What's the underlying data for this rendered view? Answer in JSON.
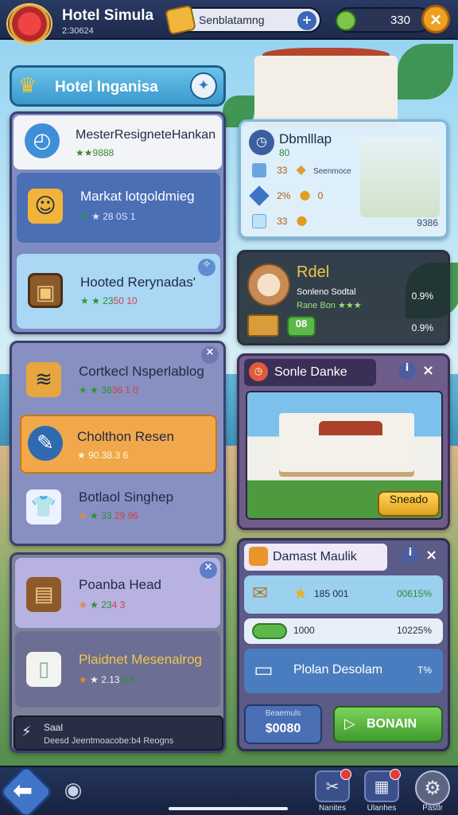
{
  "app": {
    "title": "Hotel Simula",
    "subtitle": "2:30624"
  },
  "topbar": {
    "status_label": "Senblatamng",
    "status_btn": "+",
    "coins": "330",
    "close_label": "×",
    "icons": {
      "logo": "hotel-crest",
      "status": "gold-ticket",
      "coin": "green-coin",
      "close": "close"
    }
  },
  "left_panel": {
    "header": "Hotel Inganisa",
    "items": [
      {
        "name": "MesterResigneteHankan",
        "meta": "★★9888",
        "icon": "clock-gem"
      },
      {
        "name": "Markat lotgoldmieg",
        "meta_a": "★ 28 ",
        "meta_b": "0S 1",
        "icon": "trophy-face"
      },
      {
        "name": "Hooted Rerynadas'",
        "meta_a": "★ 23",
        "meta_b": "50 10",
        "icon": "food-frame"
      }
    ]
  },
  "left_panel2": {
    "items": [
      {
        "name": "Cortkecl Nsperlablog",
        "meta_a": "★ 38",
        "meta_b": "36 1 0",
        "icon": "bread-stack"
      },
      {
        "name": "Cholthon Resen",
        "meta": "★ 90.38.3 6",
        "icon": "wand-tool"
      },
      {
        "name": "Botlaol Singhep",
        "meta_a": "★ 33 ",
        "meta_b": "29 96",
        "icon": "shirt-stars"
      }
    ]
  },
  "left_panel3": {
    "items": [
      {
        "name": "Poanba Head",
        "meta_a": "★ 23",
        "meta_b": "4 3",
        "icon": "crate"
      },
      {
        "name": "Plaidnet Mesenalrog",
        "meta_a": "★ 2.13",
        "meta_b": ".0 6",
        "icon": "towel-roll"
      }
    ],
    "footer_title": "Saal",
    "footer_text": "Deesd Jeentmoacobe:b4 Reogns"
  },
  "right_panel1": {
    "title": "Dbmlllap",
    "sub": "80",
    "rows": [
      {
        "a": "33",
        "label": "Seenmoce",
        "icon": "blue-cube"
      },
      {
        "a": "2%",
        "label": "0",
        "icon": "blue-gem"
      },
      {
        "a": "33",
        "label": "",
        "icon": "ice-cube"
      }
    ],
    "value": "9386"
  },
  "right_panel2": {
    "title": "Rdel",
    "sub1": "Sonleno Sodtal",
    "sub2": "Rane Bon ★★★",
    "v1": "0.9%",
    "v2": "0.9%",
    "badge": "08"
  },
  "right_panel3": {
    "title": "Sonle Danke",
    "info_btn": "i",
    "close_btn": "×",
    "action": "Sneado"
  },
  "right_panel4": {
    "title": "Damast Maulik",
    "info_btn": "i",
    "close_btn": "×",
    "rows": [
      {
        "a": "185 001",
        "b": "00615%"
      },
      {
        "a": "1000",
        "b": "10225%"
      }
    ],
    "row3": "Plolan Desolam",
    "row3_val": "T%",
    "cost_label": "Beaemuls",
    "cost_value": "$0080",
    "confirm_label": "BONAIN"
  },
  "bottombar": {
    "nav": [
      {
        "label": "Nanites",
        "icon": "tools"
      },
      {
        "label": "Ulanhes",
        "icon": "map-scroll"
      }
    ],
    "settings_label": "Pastlr"
  }
}
